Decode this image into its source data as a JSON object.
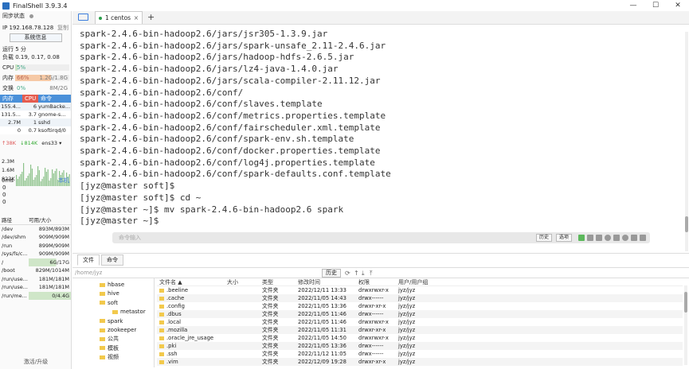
{
  "app": {
    "title": "FinalShell 3.9.3.4"
  },
  "window_controls": [
    "—",
    "☐",
    "✕"
  ],
  "left": {
    "sync_status": "同步状态",
    "ip_label": "IP 192.168.78.128",
    "copy_label": "复制",
    "sysinfo_button": "系统信息",
    "uptime": "运行 5 分",
    "load": "负载 0.19, 0.17, 0.08",
    "cpu": {
      "label": "CPU",
      "value": "5%",
      "percent": 5
    },
    "mem": {
      "label": "内存",
      "value": "66%",
      "detail": "1.2G/1.8G",
      "percent": 66
    },
    "swap": {
      "label": "交换",
      "value": "0%",
      "detail": "8M/2G",
      "percent": 0
    },
    "proc_headers": [
      "内存",
      "CPU",
      "命令"
    ],
    "processes": [
      {
        "mem": "155.4...",
        "cpu": "6",
        "cmd": "yumBacke..."
      },
      {
        "mem": "131.5...",
        "cpu": "3.7",
        "cmd": "gnome-s..."
      },
      {
        "mem": "2.7M",
        "cpu": "1",
        "cmd": "sshd"
      },
      {
        "mem": "0",
        "cpu": "0.7",
        "cmd": "ksoftirqd/0"
      }
    ],
    "net": {
      "up": "↑38K",
      "down": "↓814K",
      "iface": "ens33",
      "scale": [
        "2.3M",
        "1.6M",
        "823K"
      ]
    },
    "latency": {
      "value": "0ms",
      "host": "本机",
      "vals": [
        "0",
        "0",
        "0"
      ]
    },
    "disk_headers": [
      "路径",
      "可用/大小"
    ],
    "disks": [
      {
        "path": "/dev",
        "size": "893M/893M",
        "used": 0
      },
      {
        "path": "/dev/shm",
        "size": "909M/909M",
        "used": 0
      },
      {
        "path": "/run",
        "size": "899M/909M",
        "used": 1
      },
      {
        "path": "/sys/fs/c...",
        "size": "909M/909M",
        "used": 0
      },
      {
        "path": "/",
        "size": "6G/17G",
        "used": 65
      },
      {
        "path": "/boot",
        "size": "829M/1014M",
        "used": 18
      },
      {
        "path": "/run/use...",
        "size": "181M/181M",
        "used": 0
      },
      {
        "path": "/run/use...",
        "size": "181M/181M",
        "used": 0
      },
      {
        "path": "/run/me...",
        "size": "0/4.4G",
        "used": 100
      }
    ],
    "activate": "激活/升级"
  },
  "tabbar": {
    "tab_label": "1 centos",
    "close": "×",
    "plus": "+"
  },
  "terminal": {
    "lines": [
      "spark-2.4.6-bin-hadoop2.6/jars/jsr305-1.3.9.jar",
      "spark-2.4.6-bin-hadoop2.6/jars/spark-unsafe_2.11-2.4.6.jar",
      "spark-2.4.6-bin-hadoop2.6/jars/hadoop-hdfs-2.6.5.jar",
      "spark-2.4.6-bin-hadoop2.6/jars/lz4-java-1.4.0.jar",
      "spark-2.4.6-bin-hadoop2.6/jars/scala-compiler-2.11.12.jar",
      "spark-2.4.6-bin-hadoop2.6/conf/",
      "spark-2.4.6-bin-hadoop2.6/conf/slaves.template",
      "spark-2.4.6-bin-hadoop2.6/conf/metrics.properties.template",
      "spark-2.4.6-bin-hadoop2.6/conf/fairscheduler.xml.template",
      "spark-2.4.6-bin-hadoop2.6/conf/spark-env.sh.template",
      "spark-2.4.6-bin-hadoop2.6/conf/docker.properties.template",
      "spark-2.4.6-bin-hadoop2.6/conf/log4j.properties.template",
      "spark-2.4.6-bin-hadoop2.6/conf/spark-defaults.conf.template",
      "[jyz@master soft]$",
      "[jyz@master soft]$ cd ~",
      "[jyz@master ~]$ mv spark-2.4.6-bin-hadoop2.6 spark",
      "[jyz@master ~]$ "
    ],
    "cmd_placeholder": "命令输入",
    "history_btn": "历史",
    "options_btn": "选项"
  },
  "filemanager": {
    "tabs": [
      "文件",
      "命令"
    ],
    "path": "/home/jyz",
    "history_btn": "历史",
    "tree": [
      {
        "label": "hbase",
        "indent": 1
      },
      {
        "label": "hive",
        "indent": 1
      },
      {
        "label": "soft",
        "indent": 1
      },
      {
        "label": "metastor",
        "indent": 2
      },
      {
        "label": "spark",
        "indent": 1
      },
      {
        "label": "zookeeper",
        "indent": 1
      },
      {
        "label": "公共",
        "indent": 1
      },
      {
        "label": "模板",
        "indent": 1
      },
      {
        "label": "视频",
        "indent": 1
      }
    ],
    "headers": [
      "文件名 ▲",
      "大小",
      "类型",
      "修改时间",
      "权限",
      "用户/用户组"
    ],
    "files": [
      {
        "name": ".beeline",
        "size": "",
        "type": "文件夹",
        "mod": "2022/12/11 13:33",
        "perm": "drwxrwxr-x",
        "own": "jyz/jyz"
      },
      {
        "name": ".cache",
        "size": "",
        "type": "文件夹",
        "mod": "2022/11/05 14:43",
        "perm": "drwx------",
        "own": "jyz/jyz"
      },
      {
        "name": ".config",
        "size": "",
        "type": "文件夹",
        "mod": "2022/11/05 13:36",
        "perm": "drwxr-xr-x",
        "own": "jyz/jyz"
      },
      {
        "name": ".dbus",
        "size": "",
        "type": "文件夹",
        "mod": "2022/11/05 11:46",
        "perm": "drwx------",
        "own": "jyz/jyz"
      },
      {
        "name": ".local",
        "size": "",
        "type": "文件夹",
        "mod": "2022/11/05 11:46",
        "perm": "drwxrwxr-x",
        "own": "jyz/jyz"
      },
      {
        "name": ".mozilla",
        "size": "",
        "type": "文件夹",
        "mod": "2022/11/05 11:31",
        "perm": "drwxr-xr-x",
        "own": "jyz/jyz"
      },
      {
        "name": ".oracle_jre_usage",
        "size": "",
        "type": "文件夹",
        "mod": "2022/11/05 14:50",
        "perm": "drwxrwxr-x",
        "own": "jyz/jyz"
      },
      {
        "name": ".pki",
        "size": "",
        "type": "文件夹",
        "mod": "2022/11/05 13:36",
        "perm": "drwx------",
        "own": "jyz/jyz"
      },
      {
        "name": ".ssh",
        "size": "",
        "type": "文件夹",
        "mod": "2022/11/12 11:05",
        "perm": "drwx------",
        "own": "jyz/jyz"
      },
      {
        "name": ".vim",
        "size": "",
        "type": "文件夹",
        "mod": "2022/12/09 19:28",
        "perm": "drwxr-xr-x",
        "own": "jyz/jyz"
      }
    ]
  }
}
